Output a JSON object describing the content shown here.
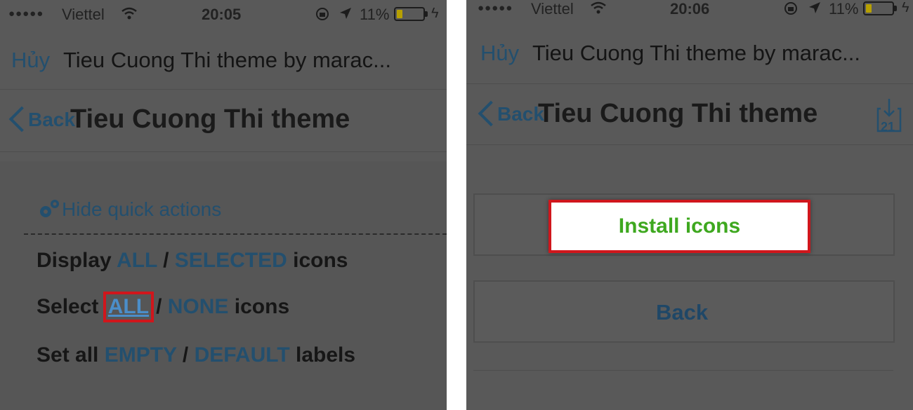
{
  "left": {
    "status": {
      "carrier": "Viettel",
      "time": "20:05",
      "battery": "11%"
    },
    "nav": {
      "cancel": "Hủy",
      "title": "Tieu Cuong Thi theme by marac..."
    },
    "subnav": {
      "back": "Back",
      "title": "Tieu Cuong Thi theme"
    },
    "quick_actions": "Hide quick actions",
    "rows": {
      "display": {
        "prefix": "Display",
        "opt1": "ALL",
        "sep": "/",
        "opt2": "SELECTED",
        "suffix": "icons"
      },
      "select": {
        "prefix": "Select",
        "opt1": "ALL",
        "sep": "/",
        "opt2": "NONE",
        "suffix": "icons"
      },
      "labels": {
        "prefix": "Set all",
        "opt1": "EMPTY",
        "sep": "/",
        "opt2": "DEFAULT",
        "suffix": "labels"
      }
    }
  },
  "right": {
    "status": {
      "carrier": "Viettel",
      "time": "20:06",
      "battery": "11%"
    },
    "nav": {
      "cancel": "Hủy",
      "title": "Tieu Cuong Thi theme by marac..."
    },
    "subnav": {
      "back": "Back",
      "title": "Tieu Cuong Thi theme",
      "download_count": "21"
    },
    "install_button": "Install icons",
    "back_button": "Back"
  },
  "colors": {
    "highlight_border": "#d0161c",
    "install_text": "#3ea81f",
    "link": "#234f6e"
  }
}
